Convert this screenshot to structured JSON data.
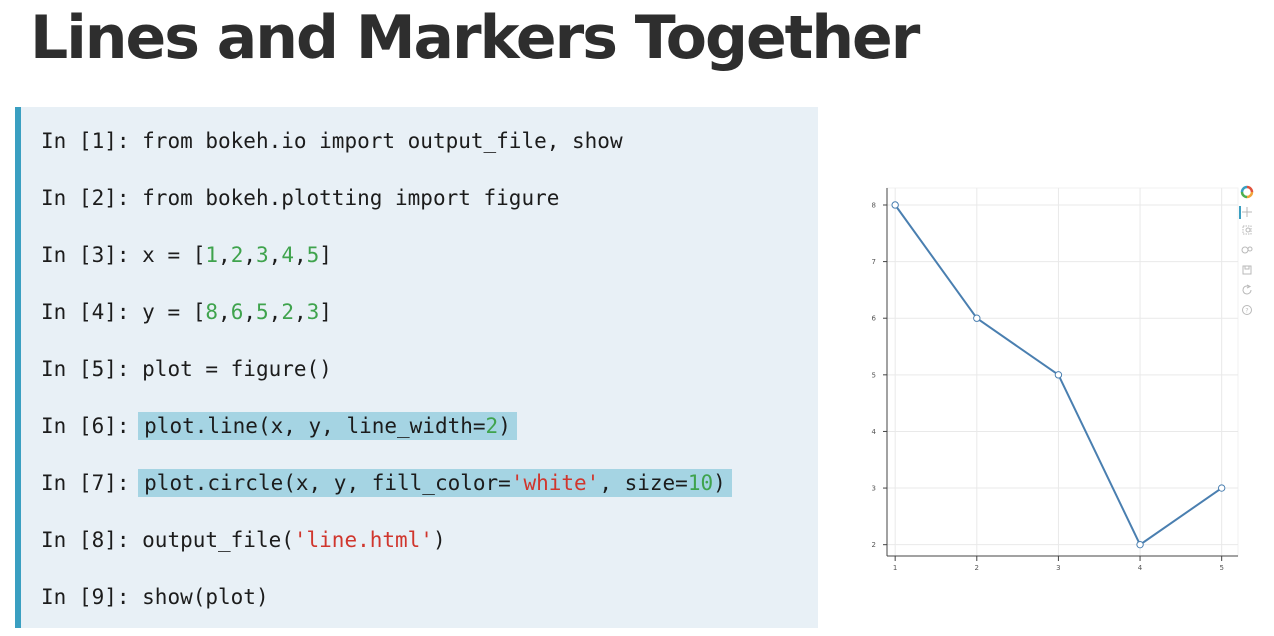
{
  "slide": {
    "title": "Lines and Markers Together"
  },
  "code": {
    "lines": [
      {
        "prompt": "In [1]: ",
        "parts": [
          {
            "t": "from bokeh.io import output_file, show",
            "k": "plain"
          }
        ]
      },
      {
        "prompt": "In [2]: ",
        "parts": [
          {
            "t": "from bokeh.plotting import figure",
            "k": "plain"
          }
        ]
      },
      {
        "prompt": "In [3]: ",
        "parts": [
          {
            "t": "x = [",
            "k": "plain"
          },
          {
            "t": "1",
            "k": "num"
          },
          {
            "t": ",",
            "k": "plain"
          },
          {
            "t": "2",
            "k": "num"
          },
          {
            "t": ",",
            "k": "plain"
          },
          {
            "t": "3",
            "k": "num"
          },
          {
            "t": ",",
            "k": "plain"
          },
          {
            "t": "4",
            "k": "num"
          },
          {
            "t": ",",
            "k": "plain"
          },
          {
            "t": "5",
            "k": "num"
          },
          {
            "t": "]",
            "k": "plain"
          }
        ]
      },
      {
        "prompt": "In [4]: ",
        "parts": [
          {
            "t": "y = [",
            "k": "plain"
          },
          {
            "t": "8",
            "k": "num"
          },
          {
            "t": ",",
            "k": "plain"
          },
          {
            "t": "6",
            "k": "num"
          },
          {
            "t": ",",
            "k": "plain"
          },
          {
            "t": "5",
            "k": "num"
          },
          {
            "t": ",",
            "k": "plain"
          },
          {
            "t": "2",
            "k": "num"
          },
          {
            "t": ",",
            "k": "plain"
          },
          {
            "t": "3",
            "k": "num"
          },
          {
            "t": "]",
            "k": "plain"
          }
        ]
      },
      {
        "prompt": "In [5]: ",
        "parts": [
          {
            "t": "plot = figure()",
            "k": "plain"
          }
        ]
      },
      {
        "prompt": "In [6]: ",
        "highlight": true,
        "parts": [
          {
            "t": "plot.line(x, y, line_width=",
            "k": "plain"
          },
          {
            "t": "2",
            "k": "num"
          },
          {
            "t": ")",
            "k": "plain"
          }
        ]
      },
      {
        "prompt": "In [7]: ",
        "highlight": true,
        "parts": [
          {
            "t": "plot.circle(x, y, fill_color=",
            "k": "plain"
          },
          {
            "t": "'white'",
            "k": "str"
          },
          {
            "t": ", size=",
            "k": "plain"
          },
          {
            "t": "10",
            "k": "num"
          },
          {
            "t": ")",
            "k": "plain"
          }
        ]
      },
      {
        "prompt": "In [8]: ",
        "parts": [
          {
            "t": "output_file(",
            "k": "plain"
          },
          {
            "t": "'line.html'",
            "k": "str"
          },
          {
            "t": ")",
            "k": "plain"
          }
        ]
      },
      {
        "prompt": "In [9]: ",
        "parts": [
          {
            "t": "show(plot)",
            "k": "plain"
          }
        ]
      }
    ]
  },
  "toolbar": {
    "tools": [
      {
        "name": "bokeh-logo-icon"
      },
      {
        "name": "pan-icon"
      },
      {
        "name": "box-zoom-icon"
      },
      {
        "name": "wheel-zoom-icon"
      },
      {
        "name": "save-icon"
      },
      {
        "name": "reset-icon"
      },
      {
        "name": "help-icon"
      }
    ]
  },
  "chart_data": {
    "type": "line",
    "x": [
      1,
      2,
      3,
      4,
      5
    ],
    "y": [
      8,
      6,
      5,
      2,
      3
    ],
    "xlim": [
      0.9,
      5.2
    ],
    "ylim": [
      1.8,
      8.3
    ],
    "xticks": [
      "1",
      "2",
      "3",
      "4",
      "5"
    ],
    "yticks": [
      "2",
      "3",
      "4",
      "5",
      "6",
      "7",
      "8"
    ],
    "grid": true,
    "markers": "circle",
    "colors": {
      "line": "#4a7fb0",
      "marker_fill": "#ffffff",
      "grid": "#e9e9e9",
      "axis": "#444444"
    }
  }
}
